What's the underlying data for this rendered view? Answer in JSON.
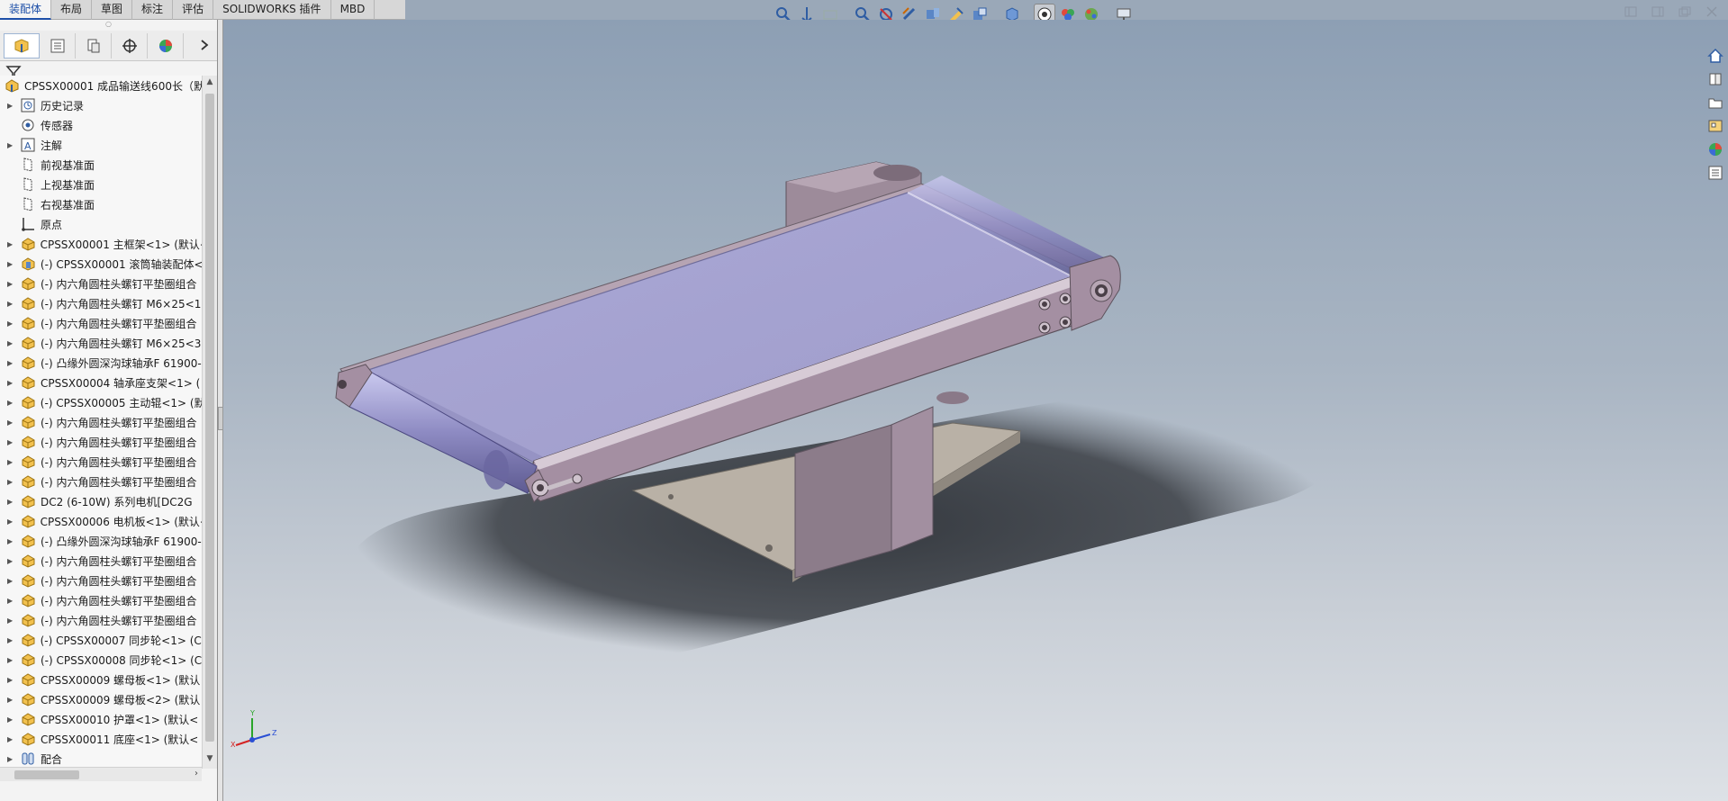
{
  "command_tabs": [
    "装配体",
    "布局",
    "草图",
    "标注",
    "评估",
    "SOLIDWORKS 插件",
    "MBD"
  ],
  "active_tab": "装配体",
  "hud_icons": [
    "zoom-to-fit-icon",
    "zoom-to-area-icon",
    "previous-view-icon",
    "section-view-icon",
    "view-orientation-icon",
    "display-style-icon",
    "hide-show-icon",
    "edit-appearance-icon",
    "apply-scene-icon",
    "view-settings-icon"
  ],
  "panel_tabs": [
    "featuremanager-tab",
    "propertymanager-tab",
    "configurationmanager-tab",
    "dimxpert-tab",
    "display-manager-tab"
  ],
  "tree": {
    "root_label": "CPSSX00001 成品输送线600长（默认",
    "items": [
      {
        "label": "历史记录",
        "icon": "history-icon",
        "expandable": true
      },
      {
        "label": "传感器",
        "icon": "sensor-icon",
        "expandable": false
      },
      {
        "label": "注解",
        "icon": "annotation-icon",
        "expandable": true
      },
      {
        "label": "前视基准面",
        "icon": "plane-icon",
        "expandable": false
      },
      {
        "label": "上视基准面",
        "icon": "plane-icon",
        "expandable": false
      },
      {
        "label": "右视基准面",
        "icon": "plane-icon",
        "expandable": false
      },
      {
        "label": "原点",
        "icon": "origin-icon",
        "expandable": false
      },
      {
        "label": "CPSSX00001 主框架<1> (默认<",
        "icon": "part-icon",
        "expandable": true
      },
      {
        "label": "(-) CPSSX00001 滚筒轴装配体<",
        "icon": "subassembly-icon",
        "expandable": true
      },
      {
        "label": "(-) 内六角圆柱头螺钉平垫圈组合",
        "icon": "part-icon",
        "expandable": true
      },
      {
        "label": "(-) 内六角圆柱头螺钉 M6×25<1",
        "icon": "part-icon",
        "expandable": true
      },
      {
        "label": "(-) 内六角圆柱头螺钉平垫圈组合",
        "icon": "part-icon",
        "expandable": true
      },
      {
        "label": "(-) 内六角圆柱头螺钉 M6×25<3",
        "icon": "part-icon",
        "expandable": true
      },
      {
        "label": "(-) 凸缘外圆深沟球轴承F 61900-",
        "icon": "part-icon",
        "expandable": true
      },
      {
        "label": "CPSSX00004 轴承座支架<1> (",
        "icon": "part-icon",
        "expandable": true
      },
      {
        "label": "(-) CPSSX00005 主动辊<1> (默",
        "icon": "part-icon",
        "expandable": true
      },
      {
        "label": "(-) 内六角圆柱头螺钉平垫圈组合",
        "icon": "part-icon",
        "expandable": true
      },
      {
        "label": "(-) 内六角圆柱头螺钉平垫圈组合",
        "icon": "part-icon",
        "expandable": true
      },
      {
        "label": "(-) 内六角圆柱头螺钉平垫圈组合",
        "icon": "part-icon",
        "expandable": true
      },
      {
        "label": "(-) 内六角圆柱头螺钉平垫圈组合",
        "icon": "part-icon",
        "expandable": true
      },
      {
        "label": "DC2 (6-10W) 系列电机[DC2G",
        "icon": "part-icon",
        "expandable": true
      },
      {
        "label": "CPSSX00006 电机板<1> (默认<",
        "icon": "part-icon",
        "expandable": true
      },
      {
        "label": "(-) 凸缘外圆深沟球轴承F 61900-",
        "icon": "part-icon",
        "expandable": true
      },
      {
        "label": "(-) 内六角圆柱头螺钉平垫圈组合",
        "icon": "part-icon",
        "expandable": true
      },
      {
        "label": "(-) 内六角圆柱头螺钉平垫圈组合",
        "icon": "part-icon",
        "expandable": true
      },
      {
        "label": "(-) 内六角圆柱头螺钉平垫圈组合",
        "icon": "part-icon",
        "expandable": true
      },
      {
        "label": "(-) 内六角圆柱头螺钉平垫圈组合",
        "icon": "part-icon",
        "expandable": true
      },
      {
        "label": "(-) CPSSX00007 同步轮<1> (CE",
        "icon": "part-icon",
        "expandable": true
      },
      {
        "label": "(-) CPSSX00008 同步轮<1> (C",
        "icon": "part-icon",
        "expandable": true
      },
      {
        "label": "CPSSX00009 螺母板<1> (默认",
        "icon": "part-icon",
        "expandable": true
      },
      {
        "label": "CPSSX00009 螺母板<2> (默认",
        "icon": "part-icon",
        "expandable": true
      },
      {
        "label": "CPSSX00010 护罩<1> (默认<",
        "icon": "part-icon",
        "expandable": true
      },
      {
        "label": "CPSSX00011 底座<1> (默认<",
        "icon": "part-icon",
        "expandable": true
      },
      {
        "label": "配合",
        "icon": "mates-icon",
        "expandable": true
      }
    ]
  },
  "task_pane_icons": [
    "home-icon",
    "design-library-icon",
    "file-explorer-icon",
    "view-palette-icon",
    "appearances-icon",
    "custom-properties-icon"
  ],
  "triad_axes": [
    "Y",
    "X",
    "Z"
  ],
  "colors": {
    "belt": "#a6a3cf",
    "frame": "#9f8b99",
    "base": "#b8b0a4",
    "accent": "#1d4fa8"
  }
}
